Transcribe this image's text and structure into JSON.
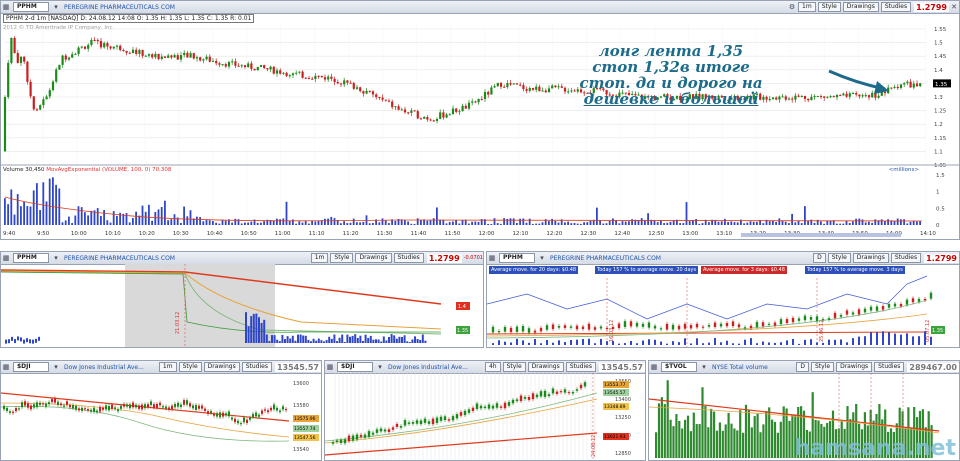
{
  "main": {
    "symbol": "PPHM",
    "company": "PEREGRINE PHARMACEUTICALS COM",
    "price": "1.2799",
    "quote_line": "PPHM 2-d 1m [NASDAQ]  D: 24.08.12 14:08  O: 1.35  H: 1.35  L: 1.35  C: 1.35  R: 0.01",
    "copyright": "2012 © TD Ameritrade IP Company, Inc.",
    "volume_label": "Volume",
    "volume_value": "30,450",
    "ma_label": "MovAvgExponential (VOLUME, 100, 0)",
    "ma_value": "70,308",
    "millions": "<millions>",
    "last_badge": "1.35",
    "timeframe": "1m",
    "style_label": "Style",
    "drawings_label": "Drawings",
    "studies_label": "Studies",
    "y_ticks": [
      "1.55",
      "1.5",
      "1.45",
      "1.4",
      "1.35",
      "1.3",
      "1.25",
      "1.2",
      "1.15",
      "1.1",
      "1.05"
    ],
    "vol_ticks": [
      "1.5",
      "1",
      "0.5",
      "0"
    ],
    "x_ticks": [
      "9:40",
      "9:50",
      "10:00",
      "10:10",
      "10:20",
      "10:30",
      "10:40",
      "10:50",
      "11:00",
      "11:10",
      "11:20",
      "11:30",
      "11:40",
      "11:50",
      "12:00",
      "12:10",
      "12:20",
      "12:30",
      "12:40",
      "12:50",
      "13:00",
      "13:10",
      "13:20",
      "13:30",
      "13:40",
      "13:50",
      "14:00",
      "14:10"
    ]
  },
  "annotation": {
    "line1": "лонг лента 1,35",
    "line2": "стоп 1,32в итоге",
    "line3": "стоп.  да и дорого на",
    "line4": "дешевке и большой"
  },
  "mid_left": {
    "symbol": "PPHM",
    "company": "PEREGRINE PHARMACEUTICALS COM",
    "price": "1.2799",
    "timeframe": "1m",
    "price_tag_red": "1.4",
    "price_tag_green": "1.35",
    "date_tag": "21.03.12",
    "change": "-0.0701"
  },
  "mid_right": {
    "symbol": "PPHM",
    "company": "PEREGRINE PHARMACEUTICALS COM",
    "price": "1.2799",
    "timeframe": "D",
    "box1": "Average move. for 20 days: $0.48",
    "box2": "Today 157 % to average move. 20 days",
    "box3": "Average move. for 3 days: $0.48",
    "box4": "Today 157 % to average move. 3 days",
    "date_tag1": "16.03.12",
    "date_tag2": "25.06.12",
    "date_tag3": "05.07.12",
    "price_tag": "1.35"
  },
  "bot_left": {
    "symbol": "$DJI",
    "company": "Dow Jones Industrial Ave...",
    "price": "13545.57",
    "timeframe": "1m",
    "y_ticks": [
      "13600",
      "13580",
      "13560",
      "13540"
    ],
    "tag1": "13575.96",
    "tag2": "13557.74",
    "tag3": "13547.56"
  },
  "bot_mid": {
    "symbol": "$DJI",
    "company": "Dow Jones Industrial Ave...",
    "price": "13545.57",
    "timeframe": "4h",
    "y_ticks": [
      "13550",
      "13400",
      "13250",
      "13000",
      "12850"
    ],
    "tag1": "13553.77",
    "tag2": "13545.57",
    "tag3": "13348.89",
    "tag4": "13021.93",
    "date_tag": "24.08.12"
  },
  "bot_right": {
    "symbol": "$TVOL",
    "company": "NYSE Total volume",
    "price": "289467.00",
    "timeframe": "D"
  },
  "watermark": "hamsana.net",
  "colors": {
    "up": "#1a8a1a",
    "down": "#cc1f1f",
    "volume": "#2f46c8",
    "ma_red": "#e03a1e",
    "ma_orange": "#e8a23a",
    "ma_green": "#7fb87f"
  }
}
